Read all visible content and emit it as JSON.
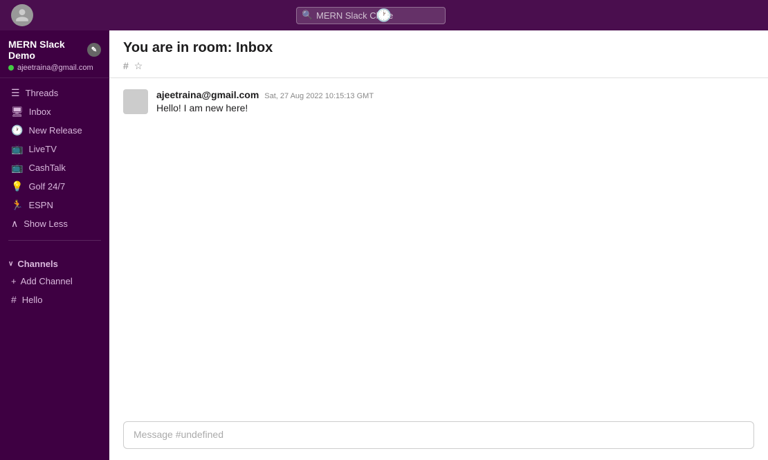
{
  "topbar": {
    "search_placeholder": "MERN Slack Clone"
  },
  "sidebar": {
    "workspace_name": "MERN Slack Demo",
    "user_email": "ajeetraina@gmail.com",
    "edit_icon": "✎",
    "nav_items": [
      {
        "id": "threads",
        "icon": "☰",
        "label": "Threads"
      },
      {
        "id": "inbox",
        "icon": "🖥",
        "label": "Inbox"
      },
      {
        "id": "new-release",
        "icon": "🕐",
        "label": "New Release"
      },
      {
        "id": "livetv",
        "icon": "📺",
        "label": "LiveTV"
      },
      {
        "id": "cashtalk",
        "icon": "📺",
        "label": "CashTalk"
      },
      {
        "id": "golf247",
        "icon": "💡",
        "label": "Golf 24/7"
      },
      {
        "id": "espn",
        "icon": "🏃",
        "label": "ESPN"
      }
    ],
    "show_less_label": "Show Less",
    "channels_label": "Channels",
    "add_channel_label": "Add Channel",
    "channel_items": [
      {
        "id": "hello",
        "label": "Hello"
      }
    ]
  },
  "content": {
    "room_title": "You are in room: Inbox",
    "hash_icon": "#",
    "star_icon": "☆"
  },
  "messages": [
    {
      "author": "ajeetraina@gmail.com",
      "timestamp": "Sat, 27 Aug 2022 10:15:13 GMT",
      "text": "Hello! I am new here!"
    }
  ],
  "input": {
    "placeholder": "Message #undefined"
  }
}
